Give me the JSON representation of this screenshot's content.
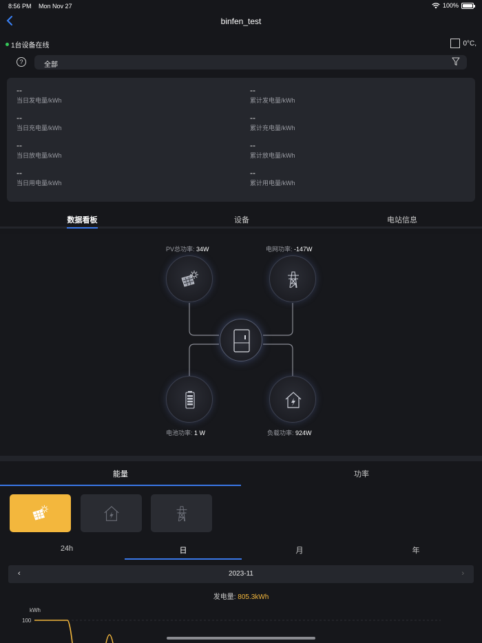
{
  "status_bar": {
    "time": "8:56 PM",
    "date": "Mon Nov 27",
    "battery": "100%"
  },
  "header": {
    "title": "binfen_test"
  },
  "device_status": {
    "online_text": "1台设备在线",
    "temperature": "0°C,"
  },
  "filter": {
    "label": "全部"
  },
  "stats": [
    {
      "value": "--",
      "label": "当日发电量/kWh"
    },
    {
      "value": "--",
      "label": "累计发电量/kWh"
    },
    {
      "value": "--",
      "label": "当日充电量/kWh"
    },
    {
      "value": "--",
      "label": "累计充电量/kWh"
    },
    {
      "value": "--",
      "label": "当日放电量/kWh"
    },
    {
      "value": "--",
      "label": "累计放电量/kWh"
    },
    {
      "value": "--",
      "label": "当日用电量/kWh"
    },
    {
      "value": "--",
      "label": "累计用电量/kWh"
    }
  ],
  "main_tabs": [
    "数据看板",
    "设备",
    "电站信息"
  ],
  "flow": {
    "pv": {
      "label": "PV总功率:",
      "value": "34W"
    },
    "grid": {
      "label": "电网功率:",
      "value": "-147W"
    },
    "battery": {
      "label": "电池功率:",
      "value": "1 W"
    },
    "load": {
      "label": "负载功率:",
      "value": "924W"
    }
  },
  "energy_tabs": [
    "能量",
    "功率"
  ],
  "period_tabs": [
    "24h",
    "日",
    "月",
    "年"
  ],
  "date_nav": {
    "prev": "‹",
    "date": "2023-11",
    "next": "›"
  },
  "generation": {
    "label": "发电量:",
    "value": "805.3kWh"
  },
  "chart_data": {
    "type": "line",
    "ylabel": "kWh",
    "y_ticks": [
      "100"
    ],
    "series": [
      {
        "values": [
          100,
          100,
          0,
          0,
          100,
          0
        ]
      }
    ],
    "color": "#f3b73d"
  }
}
